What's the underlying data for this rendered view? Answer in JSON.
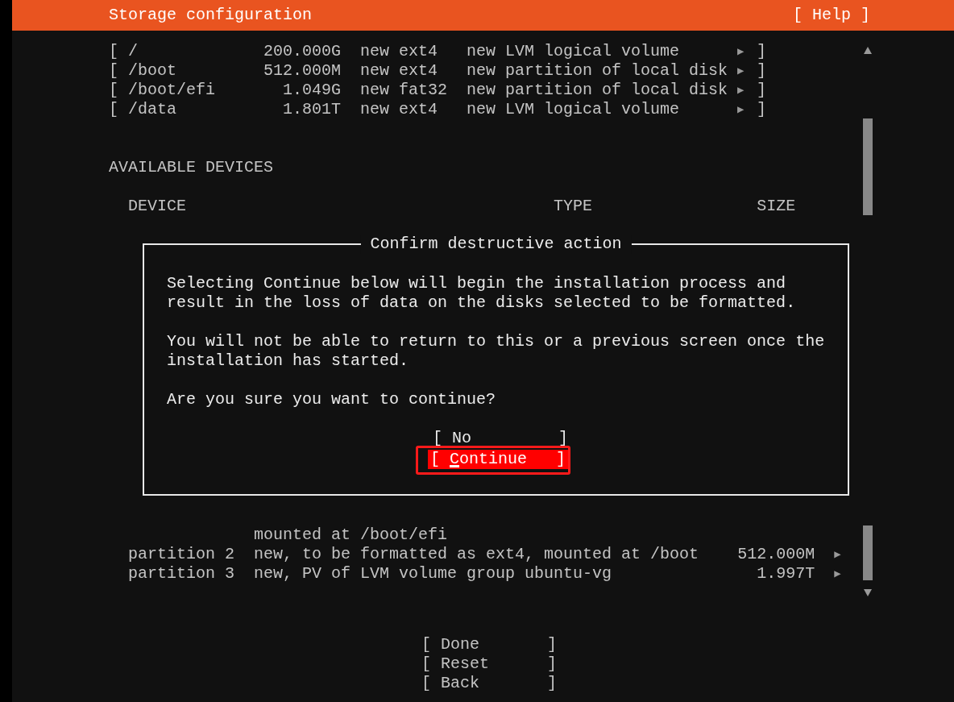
{
  "header": {
    "title": "Storage configuration",
    "help": "[ Help ]"
  },
  "filesystems": [
    {
      "open": "[",
      "mount": "/",
      "size": "200.000G",
      "format": "new ext4",
      "description": "new LVM logical volume",
      "arrow": "▶",
      "close": "]"
    },
    {
      "open": "[",
      "mount": "/boot",
      "size": "512.000M",
      "format": "new ext4",
      "description": "new partition of local disk",
      "arrow": "▶",
      "close": "]"
    },
    {
      "open": "[",
      "mount": "/boot/efi",
      "size": "1.049G",
      "format": "new fat32",
      "description": "new partition of local disk",
      "arrow": "▶",
      "close": "]"
    },
    {
      "open": "[",
      "mount": "/data",
      "size": "1.801T",
      "format": "new ext4",
      "description": "new LVM logical volume",
      "arrow": "▶",
      "close": "]"
    }
  ],
  "available_devices": {
    "heading": "AVAILABLE DEVICES",
    "columns": [
      "DEVICE",
      "TYPE",
      "SIZE"
    ]
  },
  "partitions": [
    {
      "description": "mounted at /boot/efi"
    },
    {
      "name": "partition 2",
      "description": "new, to be formatted as ext4, mounted at /boot",
      "size": "512.000M",
      "arrow": "▶"
    },
    {
      "name": "partition 3",
      "description": "new, PV of LVM volume group ubuntu-vg",
      "size": "1.997T",
      "arrow": "▶"
    }
  ],
  "dialog": {
    "title": "Confirm destructive action",
    "paragraphs": [
      [
        "Selecting Continue below will begin the installation process and",
        "result in the loss of data on the disks selected to be formatted."
      ],
      [
        "You will not be able to return to this or a previous screen once the",
        "installation has started."
      ],
      [
        "Are you sure you want to continue?"
      ]
    ],
    "buttons": [
      {
        "label": "[ No         ]",
        "selected": false,
        "highlighted": false
      },
      {
        "label": "[ Continue   ]",
        "selected": true,
        "highlighted": true
      }
    ]
  },
  "buttons": [
    "[ Done       ]",
    "[ Reset      ]",
    "[ Back       ]"
  ]
}
